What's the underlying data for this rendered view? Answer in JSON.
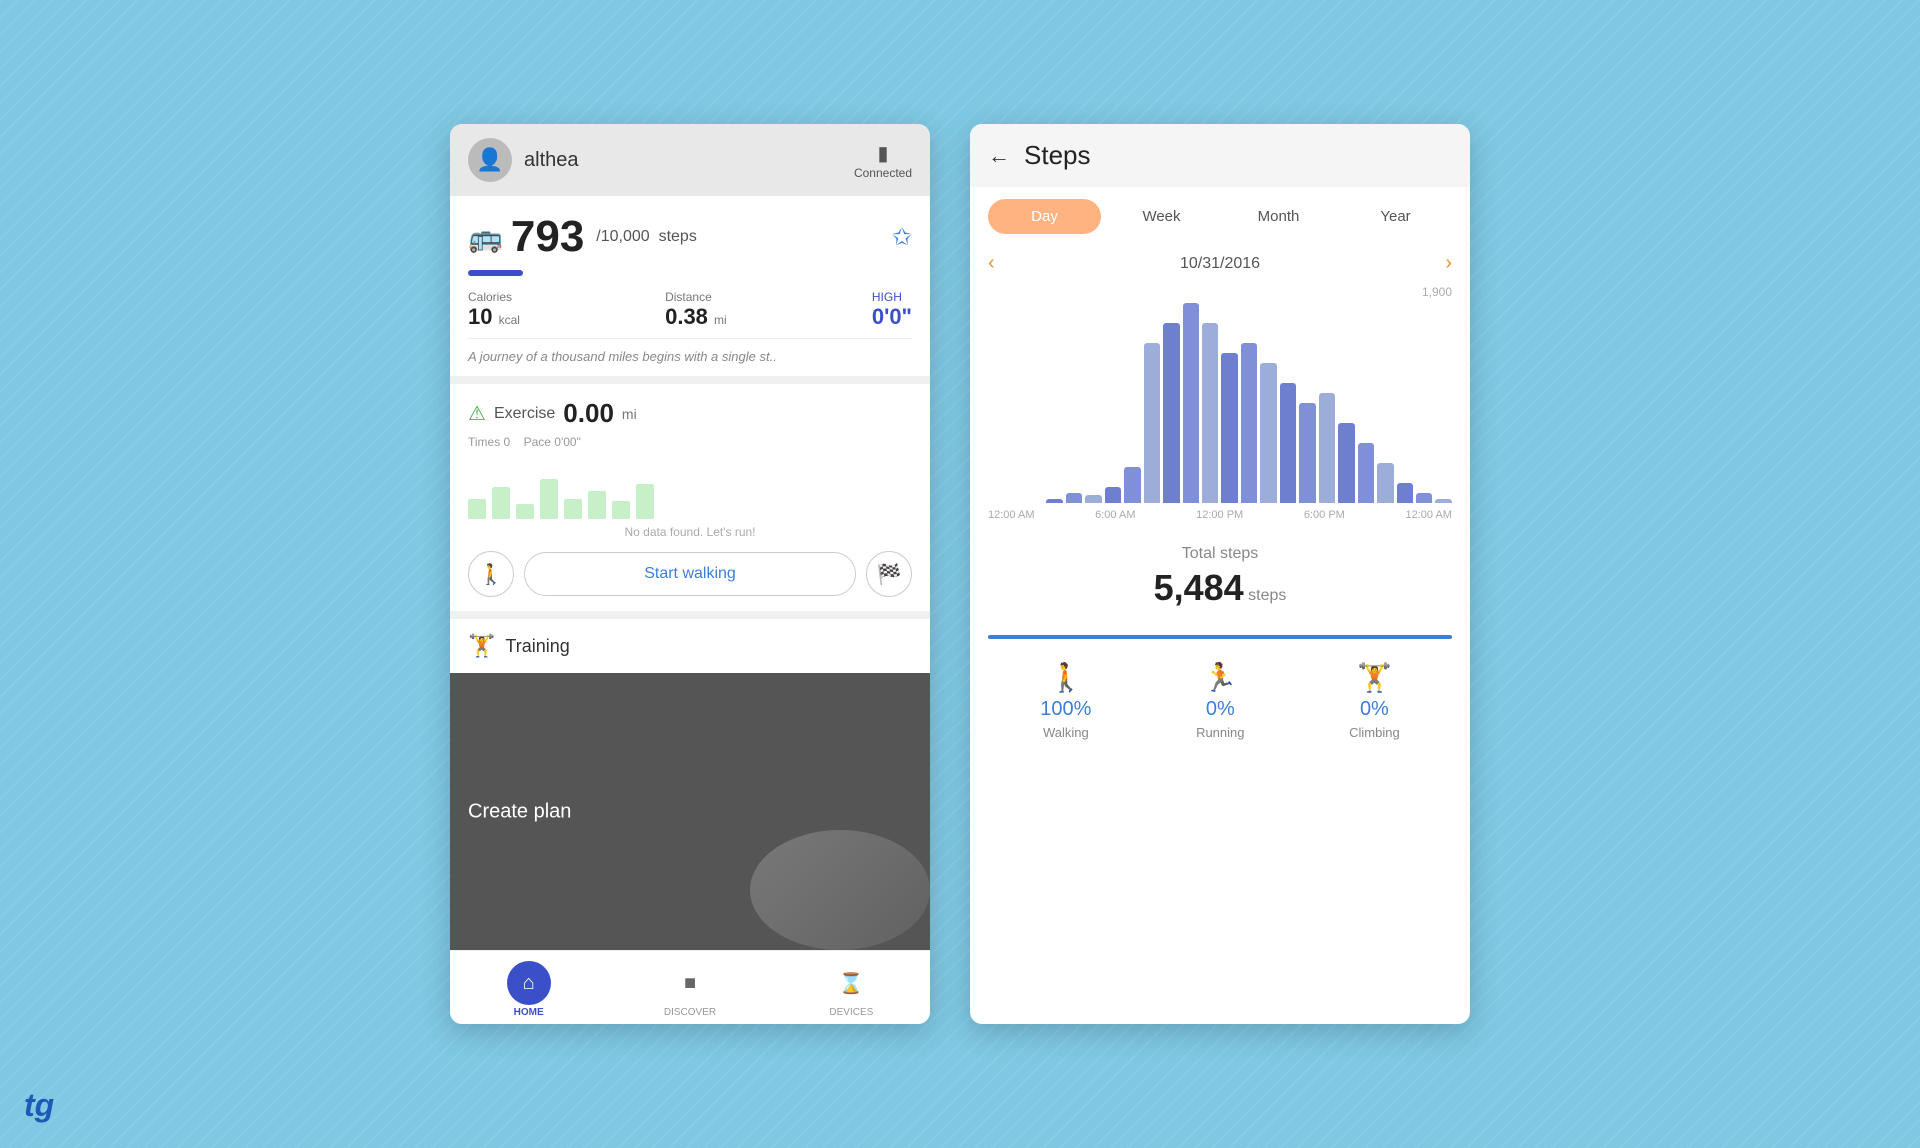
{
  "background": "#7ec8e3",
  "tg_badge": "tg",
  "left_panel": {
    "header": {
      "username": "althea",
      "status": "Connected"
    },
    "steps": {
      "count": "793",
      "goal": "/10,000",
      "unit": "steps",
      "calories_label": "Calories",
      "calories_value": "10",
      "calories_unit": "kcal",
      "distance_label": "Distance",
      "distance_value": "0.38",
      "distance_unit": "mi",
      "high_label": "HIGH",
      "high_value": "0'0\"",
      "motivation": "A journey of a thousand miles begins with a single st.."
    },
    "exercise": {
      "title": "Exercise",
      "distance": "0.00",
      "unit": "mi",
      "times": "Times 0",
      "pace": "Pace 0'00\"",
      "no_data": "No data found. Let's run!",
      "start_btn": "Start walking"
    },
    "training": {
      "label": "Training"
    },
    "create_plan": {
      "label": "Create plan"
    },
    "bottom_nav": {
      "home_label": "HOME",
      "discover_label": "DISCOVER",
      "devices_label": "DEVICES"
    }
  },
  "right_panel": {
    "header": {
      "title": "Steps"
    },
    "tabs": {
      "day": "Day",
      "week": "Week",
      "month": "Month",
      "year": "Year",
      "active": "day"
    },
    "date": "10/31/2016",
    "chart": {
      "y_max": "1,900",
      "x_labels": [
        "12:00 AM",
        "6:00 AM",
        "12:00 PM",
        "6:00 PM",
        "12:00 AM"
      ],
      "bars": [
        0,
        0,
        0,
        2,
        5,
        4,
        8,
        18,
        80,
        90,
        100,
        90,
        75,
        80,
        70,
        60,
        50,
        55,
        40,
        30,
        20,
        10,
        5,
        2
      ],
      "bar_color_primary": "#6e7fcf",
      "bar_color_light": "#9badd8"
    },
    "total_steps_label": "Total steps",
    "total_steps_value": "5,484",
    "total_steps_unit": "steps",
    "activity": {
      "walking_pct": "100%",
      "walking_label": "Walking",
      "running_pct": "0%",
      "running_label": "Running",
      "climbing_pct": "0%",
      "climbing_label": "Climbing"
    }
  }
}
